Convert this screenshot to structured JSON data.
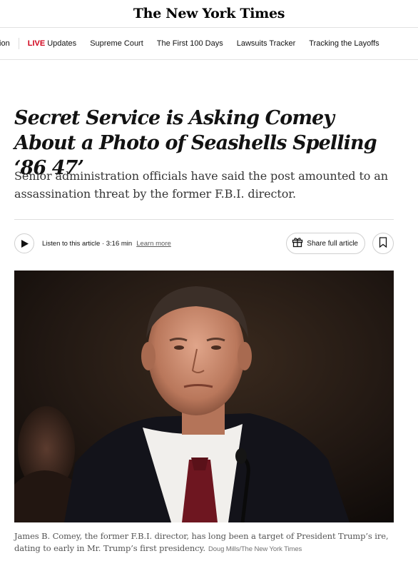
{
  "masthead": {
    "logo_text": "The New York Times"
  },
  "nav": {
    "items": [
      {
        "label": "tion"
      },
      {
        "live_tag": "LIVE",
        "label": "Updates"
      },
      {
        "label": "Supreme Court"
      },
      {
        "label": "The First 100 Days"
      },
      {
        "label": "Lawsuits Tracker"
      },
      {
        "label": "Tracking the Layoffs"
      }
    ]
  },
  "article": {
    "headline": "Secret Service is Asking Comey About a Photo of Seashells Spelling ‘86 47’",
    "summary": "Senior administration officials have said the post amounted to an assassination threat by the former F.B.I. director.",
    "listen": {
      "text": "Listen to this article · 3:16 min",
      "learn_more": "Learn more"
    },
    "share_label": "Share full article",
    "image": {
      "alt": "James B. Comey"
    },
    "caption": {
      "text": "James B. Comey, the former F.B.I. director, has long been a target of President Trump’s ire, dating to early in Mr. Trump’s first presidency.",
      "credit": "Doug Mills/The New York Times"
    }
  },
  "icons": {
    "play": "play-icon",
    "share": "gift-icon",
    "save": "bookmark-icon"
  },
  "colors": {
    "live": "#d0021b",
    "text": "#121212",
    "border": "#cfcfcf"
  }
}
